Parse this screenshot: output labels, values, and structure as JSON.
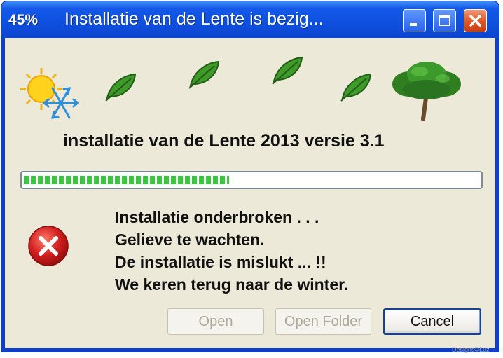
{
  "window": {
    "title_percent": "45%",
    "title": "Installatie van de Lente is bezig...",
    "controls": {
      "minimize_icon": "minimize-icon",
      "maximize_icon": "maximize-icon",
      "close_icon": "close-icon"
    }
  },
  "banner_icons": [
    "sun-snowflake-icon",
    "leaf-icon",
    "leaf-icon",
    "leaf-icon",
    "leaf-icon",
    "tree-icon"
  ],
  "headline": "installatie van de Lente 2013 versie 3.1",
  "progress": {
    "value": 0.45
  },
  "error": {
    "icon": "error-icon",
    "lines": [
      "Installatie onderbroken . . .",
      "Gelieve te wachten.",
      "De installatie is mislukt ... !!",
      "We keren terug naar de winter."
    ]
  },
  "buttons": {
    "open": "Open",
    "open_folder": "Open Folder",
    "cancel": "Cancel"
  },
  "watermark": "Designs©Luz",
  "colors": {
    "titlebar": "#0f4fde",
    "client_bg": "#ece9d8",
    "progress_fill": "#38c83e",
    "error_red": "#d21f1f",
    "leaf_green": "#3f9a2a"
  }
}
